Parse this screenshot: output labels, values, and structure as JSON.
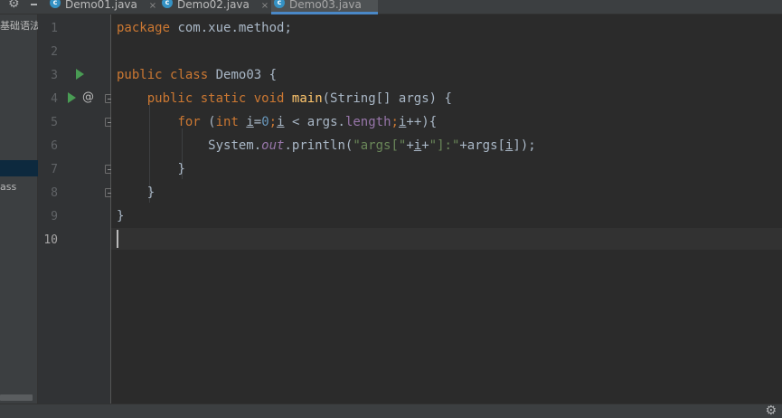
{
  "tabs": [
    {
      "label": "Demo01.java",
      "close": "×",
      "active": false
    },
    {
      "label": "Demo02.java",
      "close": "×",
      "active": false
    },
    {
      "label": "Demo03.java",
      "close": "×",
      "active": true
    }
  ],
  "tab_icon_letter": "c",
  "toolbar": {
    "gear_glyph": "⚙",
    "minimize_glyph": "-"
  },
  "side_panel": {
    "item_1": "基础语法",
    "item_2": "ass"
  },
  "editor": {
    "line_numbers": [
      "1",
      "2",
      "3",
      "4",
      "5",
      "6",
      "7",
      "8",
      "9",
      "10"
    ],
    "current_line": "10",
    "line1": {
      "kw": "package",
      "rest": " com.xue.method;"
    },
    "line3": {
      "kw1": "public",
      "kw2": "class",
      "name": " Demo03 {"
    },
    "line4": {
      "kw1": "public",
      "kw2": "static",
      "kw3": "void",
      "fn": "main",
      "rest": "(String[] args) {"
    },
    "line5": {
      "kw1": "for",
      "p1": " (",
      "kw2": "int",
      "sp": " ",
      "var1": "i",
      "eq": "=",
      "num": "0",
      "semi1": ";",
      "var2": "i",
      "mid": " < args.",
      "field": "length",
      "semi2": ";",
      "var3": "i",
      "end": "++){"
    },
    "line6": {
      "p1": "System.",
      "static_field": "out",
      "p2": ".println(",
      "str1": "\"args[\"",
      "plus1": "+",
      "var": "i",
      "plus2": "+",
      "str2": "\"]:\"",
      "p3": "+args[",
      "var2": "i",
      "p4": "]);"
    },
    "line7": "}",
    "line8": "}",
    "line9": "}",
    "at_glyph": "@"
  },
  "colors": {
    "keyword": "#cc7832",
    "function": "#ffc66d",
    "number": "#6897bb",
    "string": "#6a8759",
    "field": "#9876aa",
    "run_icon": "#499c54",
    "tab_accent": "#4a88c7"
  },
  "icons": [
    "gear-icon",
    "run-icon",
    "override-icon",
    "fold-icon",
    "java-class-icon"
  ]
}
